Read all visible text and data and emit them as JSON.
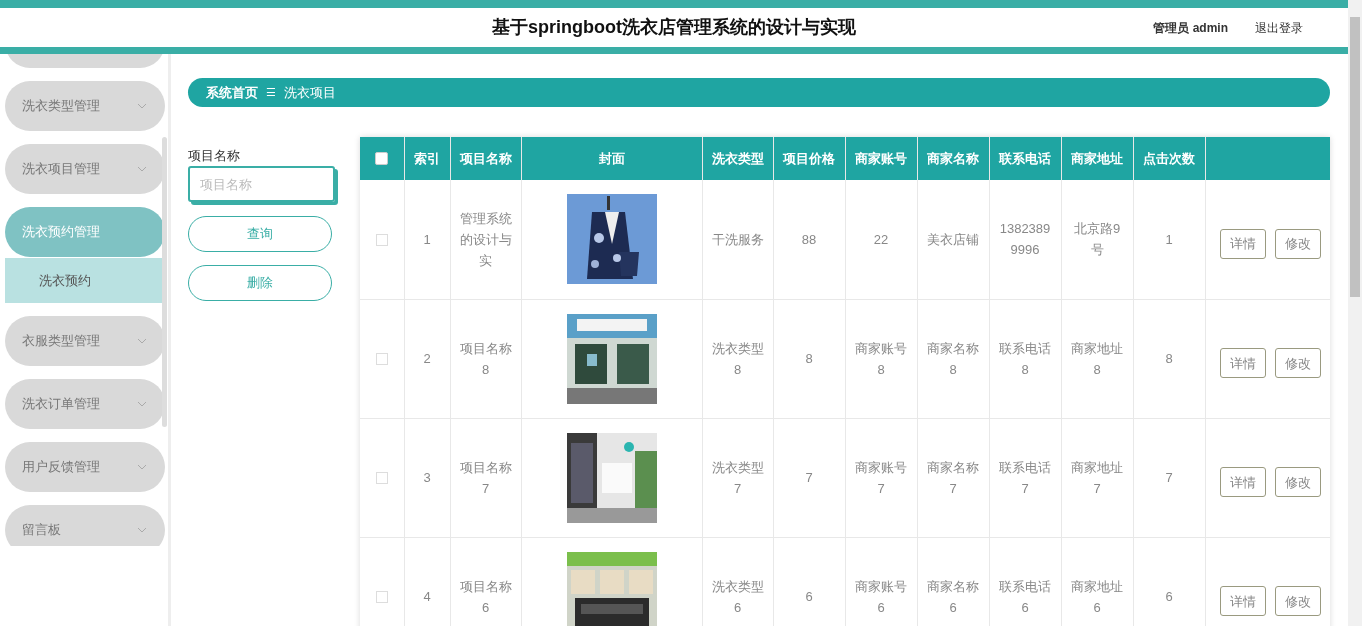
{
  "header": {
    "title": "基于springboot洗衣店管理系统的设计与实现",
    "user": "管理员 admin",
    "logout": "退出登录"
  },
  "sidebar": {
    "items": [
      {
        "label": "洗衣类型管理",
        "selected": false,
        "expanded": false
      },
      {
        "label": "洗衣项目管理",
        "selected": false,
        "expanded": false
      },
      {
        "label": "洗衣预约管理",
        "selected": true,
        "expanded": true,
        "children": [
          {
            "label": "洗衣预约"
          }
        ]
      },
      {
        "label": "衣服类型管理",
        "selected": false,
        "expanded": false
      },
      {
        "label": "洗衣订单管理",
        "selected": false,
        "expanded": false
      },
      {
        "label": "用户反馈管理",
        "selected": false,
        "expanded": false
      },
      {
        "label": "留言板",
        "selected": false,
        "expanded": false
      }
    ]
  },
  "breadcrumb": [
    "系统首页",
    "洗衣项目"
  ],
  "breadcrumb_separator": "☰",
  "search": {
    "label": "项目名称",
    "placeholder": "项目名称",
    "buttons": [
      "查询",
      "删除"
    ]
  },
  "table": {
    "select_all_checked": false,
    "columns": [
      "索引",
      "项目名称",
      "封面",
      "洗衣类型",
      "项目价格",
      "商家账号",
      "商家名称",
      "联系电话",
      "商家地址",
      "点击次数"
    ],
    "rows": [
      {
        "checked": false,
        "cells": [
          "1",
          "管理系统的设计与实",
          "",
          "干洗服务",
          "88",
          "22",
          "美衣店铺",
          "13823899996",
          "北京路9号",
          "1"
        ],
        "actions": [
          "详情",
          "修改"
        ]
      },
      {
        "checked": false,
        "cells": [
          "2",
          "项目名称8",
          "",
          "洗衣类型8",
          "8",
          "商家账号8",
          "商家名称8",
          "联系电话8",
          "商家地址8",
          "8"
        ],
        "actions": [
          "详情",
          "修改"
        ]
      },
      {
        "checked": false,
        "cells": [
          "3",
          "项目名称7",
          "",
          "洗衣类型7",
          "7",
          "商家账号7",
          "商家名称7",
          "联系电话7",
          "商家地址7",
          "7"
        ],
        "actions": [
          "详情",
          "修改"
        ]
      },
      {
        "checked": false,
        "cells": [
          "4",
          "项目名称6",
          "",
          "洗衣类型6",
          "6",
          "商家账号6",
          "商家名称6",
          "联系电话6",
          "商家地址6",
          "6"
        ],
        "actions": [
          "详情",
          "修改"
        ]
      }
    ]
  }
}
